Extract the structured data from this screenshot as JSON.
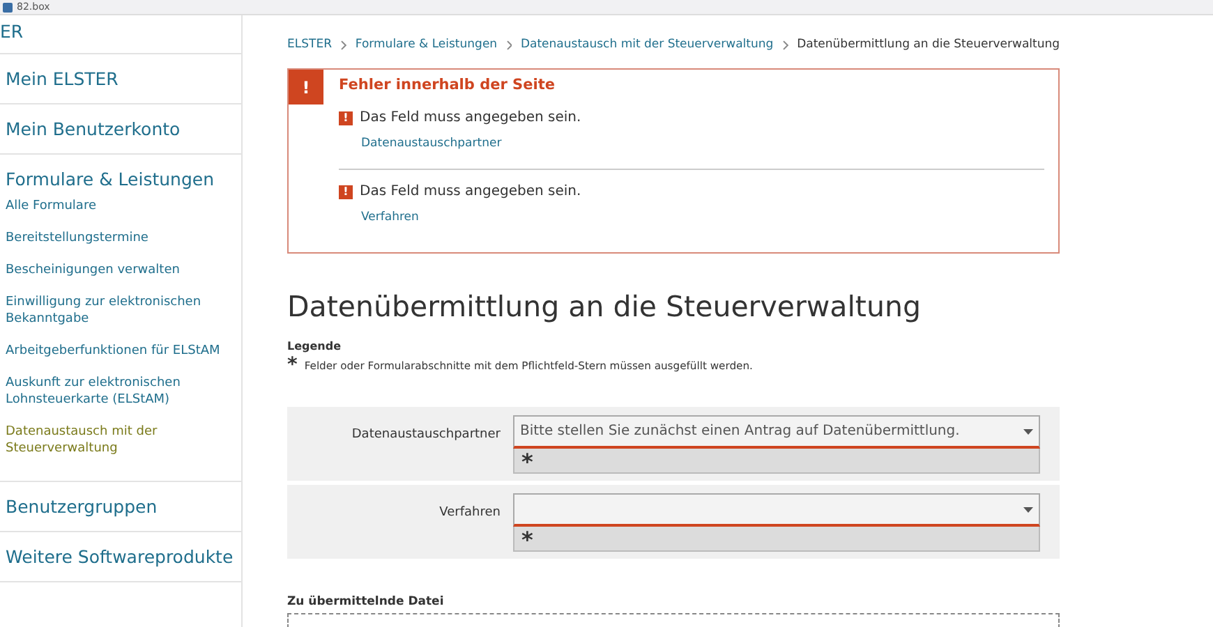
{
  "browser_tab": {
    "title": "82.box"
  },
  "sidebar": {
    "items": [
      {
        "label": "ER",
        "selected": false
      },
      {
        "label": "Mein ELSTER",
        "selected": false
      },
      {
        "label": "Mein Benutzerkonto",
        "selected": false
      },
      {
        "label": "Formulare & Leistungen",
        "selected": false,
        "children": [
          {
            "label": "Alle Formulare",
            "selected": false
          },
          {
            "label": "Bereitstellungstermine",
            "selected": false
          },
          {
            "label": "Bescheinigungen verwalten",
            "selected": false
          },
          {
            "label": "Einwilligung zur elektronischen Bekanntgabe",
            "selected": false
          },
          {
            "label": "Arbeitgeberfunktionen für ELStAM",
            "selected": false
          },
          {
            "label": "Auskunft zur elektronischen Lohnsteuerkarte (ELStAM)",
            "selected": false
          },
          {
            "label": "Datenaustausch mit der Steuerverwaltung",
            "selected": true
          }
        ]
      },
      {
        "label": "Benutzergruppen",
        "selected": false
      },
      {
        "label": "Weitere Softwareprodukte",
        "selected": false
      }
    ]
  },
  "breadcrumb": [
    "ELSTER",
    "Formulare & Leistungen",
    "Datenaustausch mit der Steuerverwaltung",
    "Datenübermittlung an die Steuerverwaltung"
  ],
  "error_box": {
    "icon": "!",
    "title": "Fehler innerhalb der Seite",
    "errors": [
      {
        "icon": "!",
        "message": "Das Feld muss angegeben sein.",
        "link": "Datenaustauschpartner"
      },
      {
        "icon": "!",
        "message": "Das Feld muss angegeben sein.",
        "link": "Verfahren"
      }
    ]
  },
  "page_title": "Datenübermittlung an die Steuerverwaltung",
  "legend": {
    "title": "Legende",
    "mark": "*",
    "text": "Felder oder Formularabschnitte mit dem Pflichtfeld-Stern müssen ausgefüllt werden."
  },
  "fields": [
    {
      "label": "Datenaustauschpartner",
      "value": "Bitte stellen Sie zunächst einen Antrag auf Datenübermittlung.",
      "required_mark": "*",
      "error": true
    },
    {
      "label": "Verfahren",
      "required_mark": "*",
      "error": true
    }
  ],
  "upload": {
    "label": "Zu übermittelnde Datei"
  }
}
